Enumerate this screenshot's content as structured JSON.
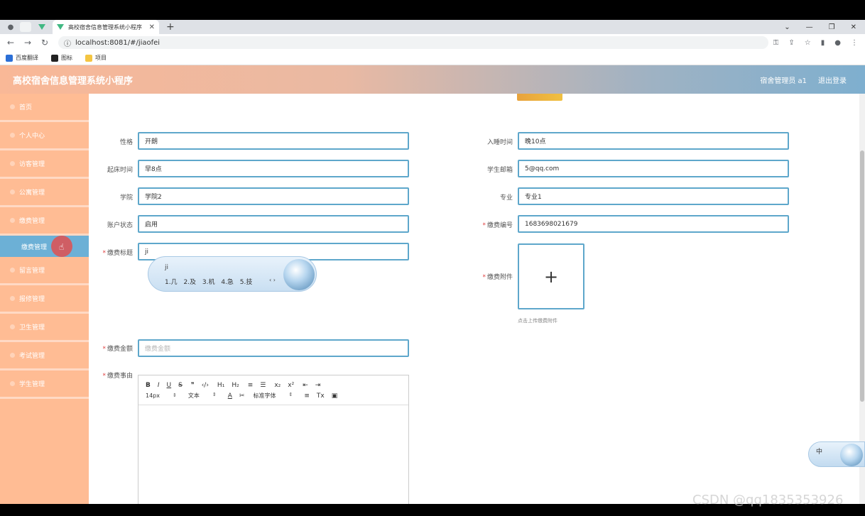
{
  "browser": {
    "tab_title": "高校宿舍信息管理系统小程序",
    "url": "localhost:8081/#/jiaofei",
    "bookmarks": [
      "百度翻译",
      "图标",
      "项目"
    ],
    "colors": {
      "tab_bar": "#dee1e6",
      "vue_green": "#41b883"
    }
  },
  "header": {
    "title": "高校宿舍信息管理系统小程序",
    "user": "宿舍管理员 a1",
    "logout": "退出登录"
  },
  "sidebar": {
    "items": [
      {
        "label": "首页"
      },
      {
        "label": "个人中心"
      },
      {
        "label": "访客管理"
      },
      {
        "label": "公寓管理"
      },
      {
        "label": "缴费管理"
      },
      {
        "label": "留言管理"
      },
      {
        "label": "报修管理"
      },
      {
        "label": "卫生管理"
      },
      {
        "label": "考试管理"
      },
      {
        "label": "学生管理"
      }
    ],
    "active_sub": "缴费管理",
    "colors": {
      "bg": "#ffbc94",
      "active": "#6cb0d6"
    }
  },
  "form": {
    "xingge": {
      "label": "性格",
      "value": "开朗"
    },
    "ruShuiShiJian": {
      "label": "入睡时间",
      "value": "晚10点"
    },
    "qiChuangShiJian": {
      "label": "起床时间",
      "value": "早8点"
    },
    "xueShengYouXiang": {
      "label": "学生邮箱",
      "value": "5@qq.com"
    },
    "xueYuan": {
      "label": "学院",
      "value": "学院2"
    },
    "zhuanYe": {
      "label": "专业",
      "value": "专业1"
    },
    "zhangHuZhuangTai": {
      "label": "账户状态",
      "value": "启用"
    },
    "jiaoFeiBianHao": {
      "label": "缴费编号",
      "value": "1683698021679",
      "required": "*"
    },
    "jiaoFeiBiaoTi": {
      "label": "缴费标题",
      "value": "ji",
      "required": "*"
    },
    "jiaoFeiFuJian": {
      "label": "缴费附件",
      "required": "*",
      "hint": "点击上传缴费附件",
      "plus": "+"
    },
    "jiaoFeiJinE": {
      "label": "缴费金额",
      "placeholder": "缴费金额",
      "required": "*"
    },
    "jiaoFeiShiYou": {
      "label": "缴费事由",
      "required": "*"
    }
  },
  "ime": {
    "composition": "ji",
    "candidates": "1.几 2.及 3.机 4.急 5.技",
    "nav": "‹ ›",
    "float_label": "中"
  },
  "editor": {
    "row1": [
      "B",
      "I",
      "U",
      "S",
      "❞",
      "‹/›",
      "H₁",
      "H₂",
      "≡",
      "☰",
      "x₂",
      "x²",
      "⇤",
      "⇥"
    ],
    "size": "14px",
    "format": "文本",
    "font": "标准字体",
    "row2_icons": [
      "A",
      "✂",
      "≡",
      "Tx",
      "▣"
    ]
  },
  "watermark": "CSDN @qq1835353926"
}
